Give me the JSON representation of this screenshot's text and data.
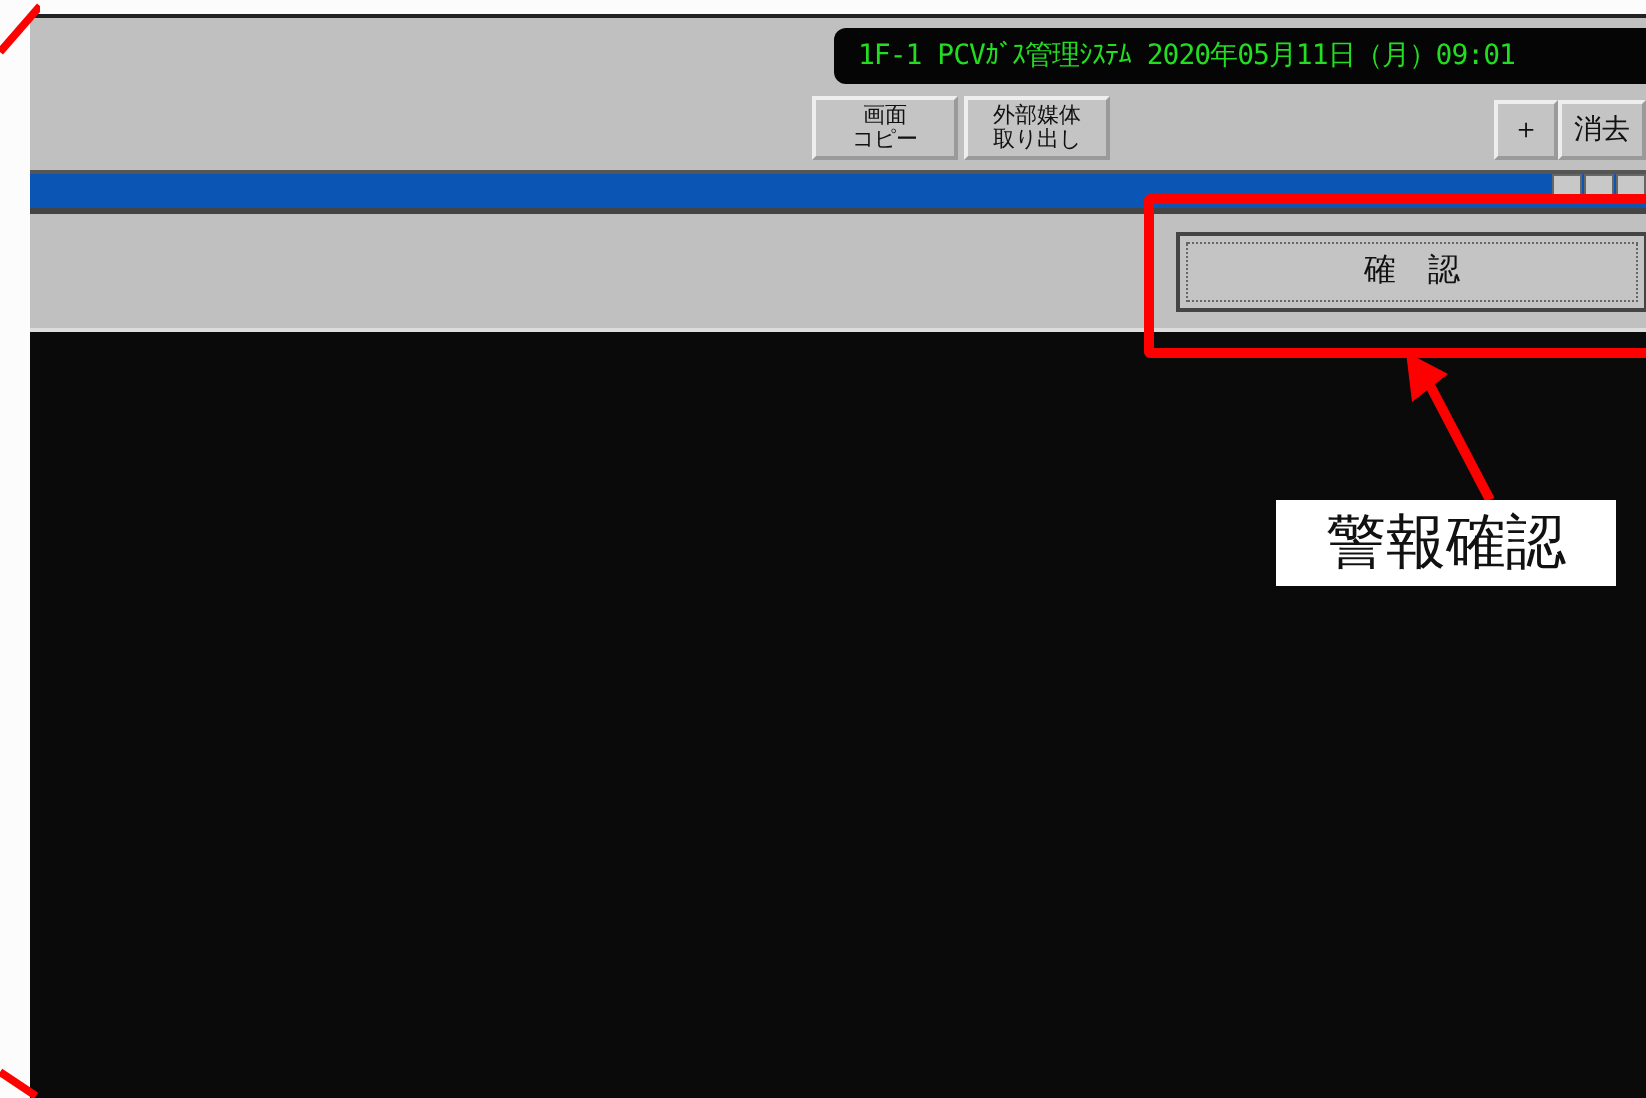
{
  "status_display": {
    "text": "1F-1 PCVｶﾞｽ管理ｼｽﾃﾑ 2020年05月11日（月）09:01"
  },
  "toolbar_left": [
    {
      "lines": [
        "画面",
        "コピー"
      ]
    },
    {
      "lines": [
        "外部媒体",
        "取り出し"
      ]
    }
  ],
  "toolbar_right": [
    {
      "label": "＋"
    },
    {
      "label": "消去"
    }
  ],
  "confirm_button": {
    "label": "確　認"
  },
  "callout": {
    "label": "警報確認"
  }
}
